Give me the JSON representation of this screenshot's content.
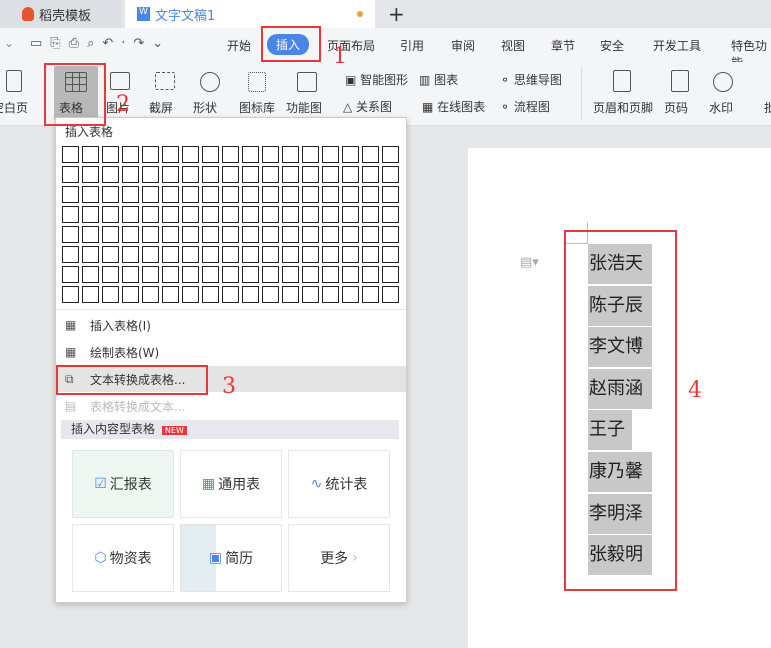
{
  "tabs": [
    {
      "label": "稻壳模板",
      "icon": "docer-icon"
    },
    {
      "label": "文字文稿1",
      "icon": "word-doc-icon"
    }
  ],
  "new_tab": "+",
  "menu": {
    "items": [
      "开始",
      "插入",
      "页面布局",
      "引用",
      "审阅",
      "视图",
      "章节",
      "安全",
      "开发工具",
      "特色功能"
    ],
    "active": "插入"
  },
  "ribbon": {
    "blank_page": "空白页",
    "table": "表格",
    "picture": "图片",
    "screenshot": "截屏",
    "shape": "形状",
    "icon_lib": "图标库",
    "func_chart": "功能图",
    "smart_art": "智能图形",
    "chart": "图表",
    "mind_map": "思维导图",
    "relation": "关系图",
    "online_chart": "在线图表",
    "flowchart": "流程图",
    "header_footer": "页眉和页脚",
    "page_num": "页码",
    "watermark": "水印",
    "more": "批"
  },
  "dropdown": {
    "title": "插入表格",
    "grid_cols": 17,
    "grid_rows": 8,
    "items": [
      {
        "label": "插入表格(I)",
        "icon": "table-icon"
      },
      {
        "label": "绘制表格(W)",
        "icon": "draw-table-icon"
      },
      {
        "label": "文本转换成表格...",
        "icon": "text-to-table-icon"
      },
      {
        "label": "表格转换成文本...",
        "icon": "table-to-text-icon",
        "disabled": true
      }
    ],
    "section": "插入内容型表格",
    "badge": "NEW",
    "cards": [
      {
        "label": "汇报表",
        "icon": "report-icon"
      },
      {
        "label": "通用表",
        "icon": "grid-icon"
      },
      {
        "label": "统计表",
        "icon": "line-chart-icon"
      },
      {
        "label": "物资表",
        "icon": "box-icon"
      },
      {
        "label": "简历",
        "icon": "resume-icon"
      },
      {
        "label": "更多",
        "icon": "chevron-right-icon"
      }
    ]
  },
  "document": {
    "names": [
      "张浩天",
      "陈子辰",
      "李文博",
      "赵雨涵",
      "王子",
      "康乃馨",
      "李明泽",
      "张毅明"
    ]
  },
  "annotations": [
    "1",
    "2",
    "3",
    "4"
  ],
  "colors": {
    "accent": "#4a86e8",
    "annotation": "#e5393b",
    "selection": "#c8c8c8"
  }
}
